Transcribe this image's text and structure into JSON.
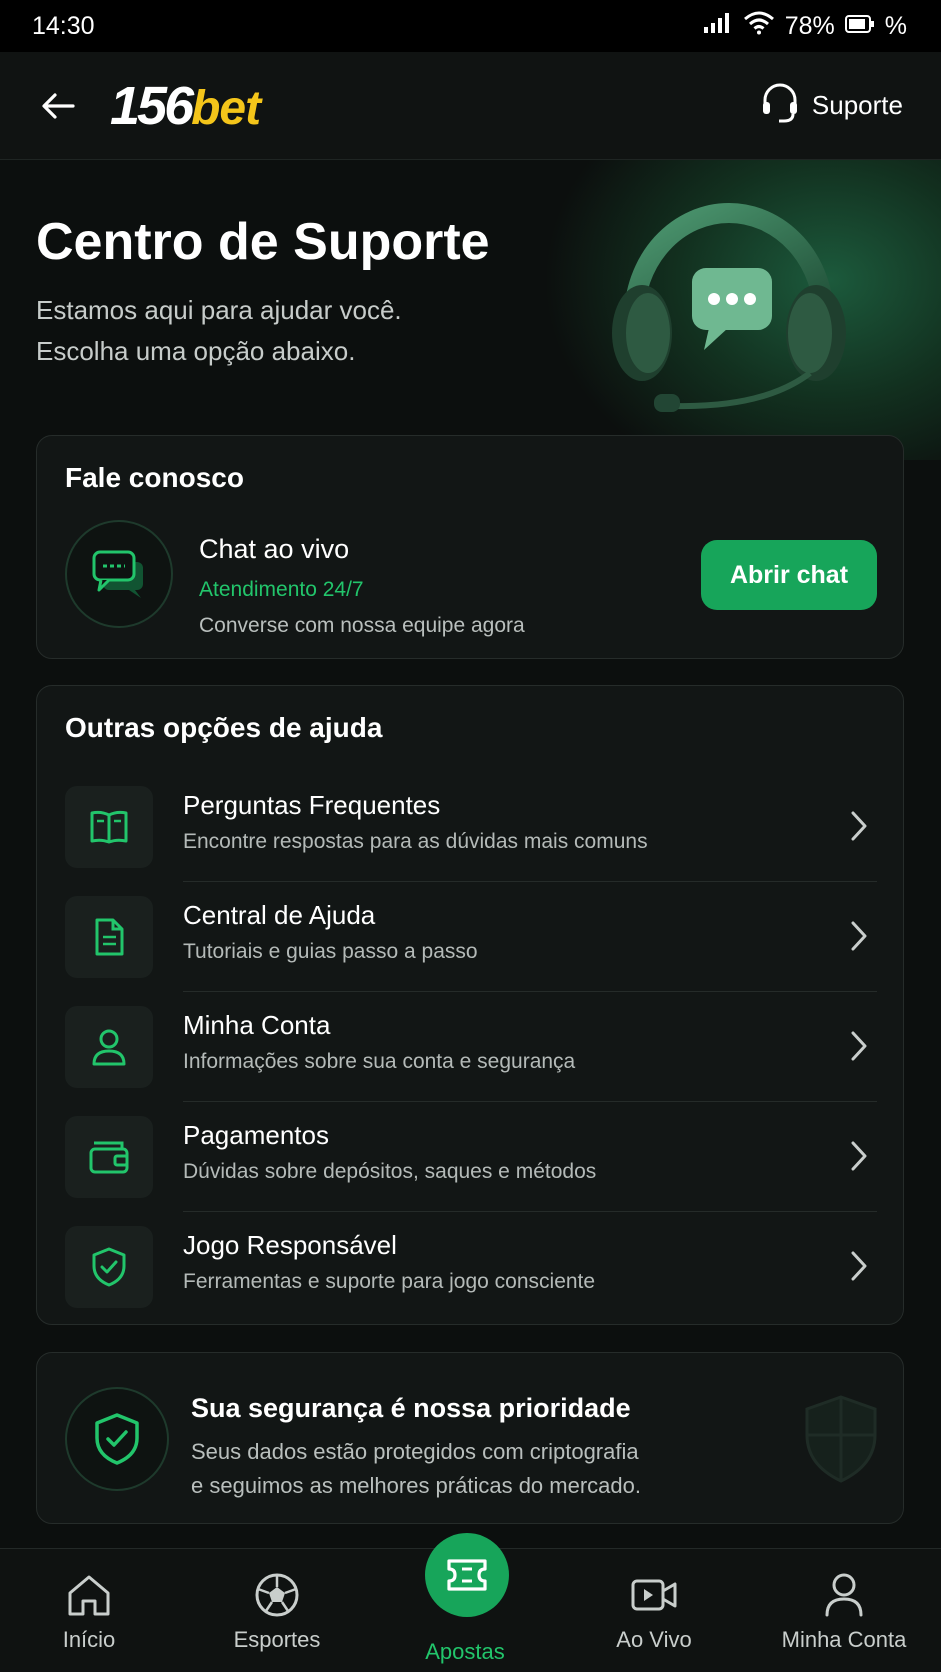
{
  "status_bar": {
    "time": "14:30",
    "battery": "78%",
    "battery_suffix": "%"
  },
  "header": {
    "logo_number": "156",
    "logo_brand": "bet",
    "support_label": "Suporte",
    "brand_color": "#f4c51a"
  },
  "hero": {
    "title": "Centro de Suporte",
    "subtitle_line1": "Estamos aqui para ajudar você.",
    "subtitle_line2": "Escolha uma opção abaixo."
  },
  "contact": {
    "title": "Fale conosco",
    "chat_name": "Chat ao vivo",
    "chat_hours": "Atendimento 24/7",
    "chat_desc": "Converse com nossa equipe agora",
    "open_button": "Abrir chat",
    "accent_color": "#17a55a"
  },
  "options": {
    "title": "Outras opções de ajuda",
    "items": [
      {
        "title": "Perguntas Frequentes",
        "desc": "Encontre respostas para as dúvidas mais comuns",
        "icon": "book-icon"
      },
      {
        "title": "Central de Ajuda",
        "desc": "Tutoriais e guias passo a passo",
        "icon": "document-icon"
      },
      {
        "title": "Minha Conta",
        "desc": "Informações sobre sua conta e segurança",
        "icon": "user-icon"
      },
      {
        "title": "Pagamentos",
        "desc": "Dúvidas sobre depósitos, saques e métodos",
        "icon": "wallet-icon"
      },
      {
        "title": "Jogo Responsável",
        "desc": "Ferramentas e suporte para jogo consciente",
        "icon": "shield-check-icon"
      }
    ]
  },
  "security": {
    "title": "Sua segurança é nossa prioridade",
    "desc_line1": "Seus dados estão protegidos com criptografia",
    "desc_line2": "e seguimos as melhores práticas do mercado."
  },
  "bottom_nav": {
    "items": [
      {
        "label": "Início",
        "icon": "home-icon"
      },
      {
        "label": "Esportes",
        "icon": "soccer-ball-icon"
      },
      {
        "label": "Apostas",
        "icon": "ticket-icon",
        "active": true
      },
      {
        "label": "Ao Vivo",
        "icon": "video-camera-icon"
      },
      {
        "label": "Minha Conta",
        "icon": "user-icon"
      }
    ]
  }
}
